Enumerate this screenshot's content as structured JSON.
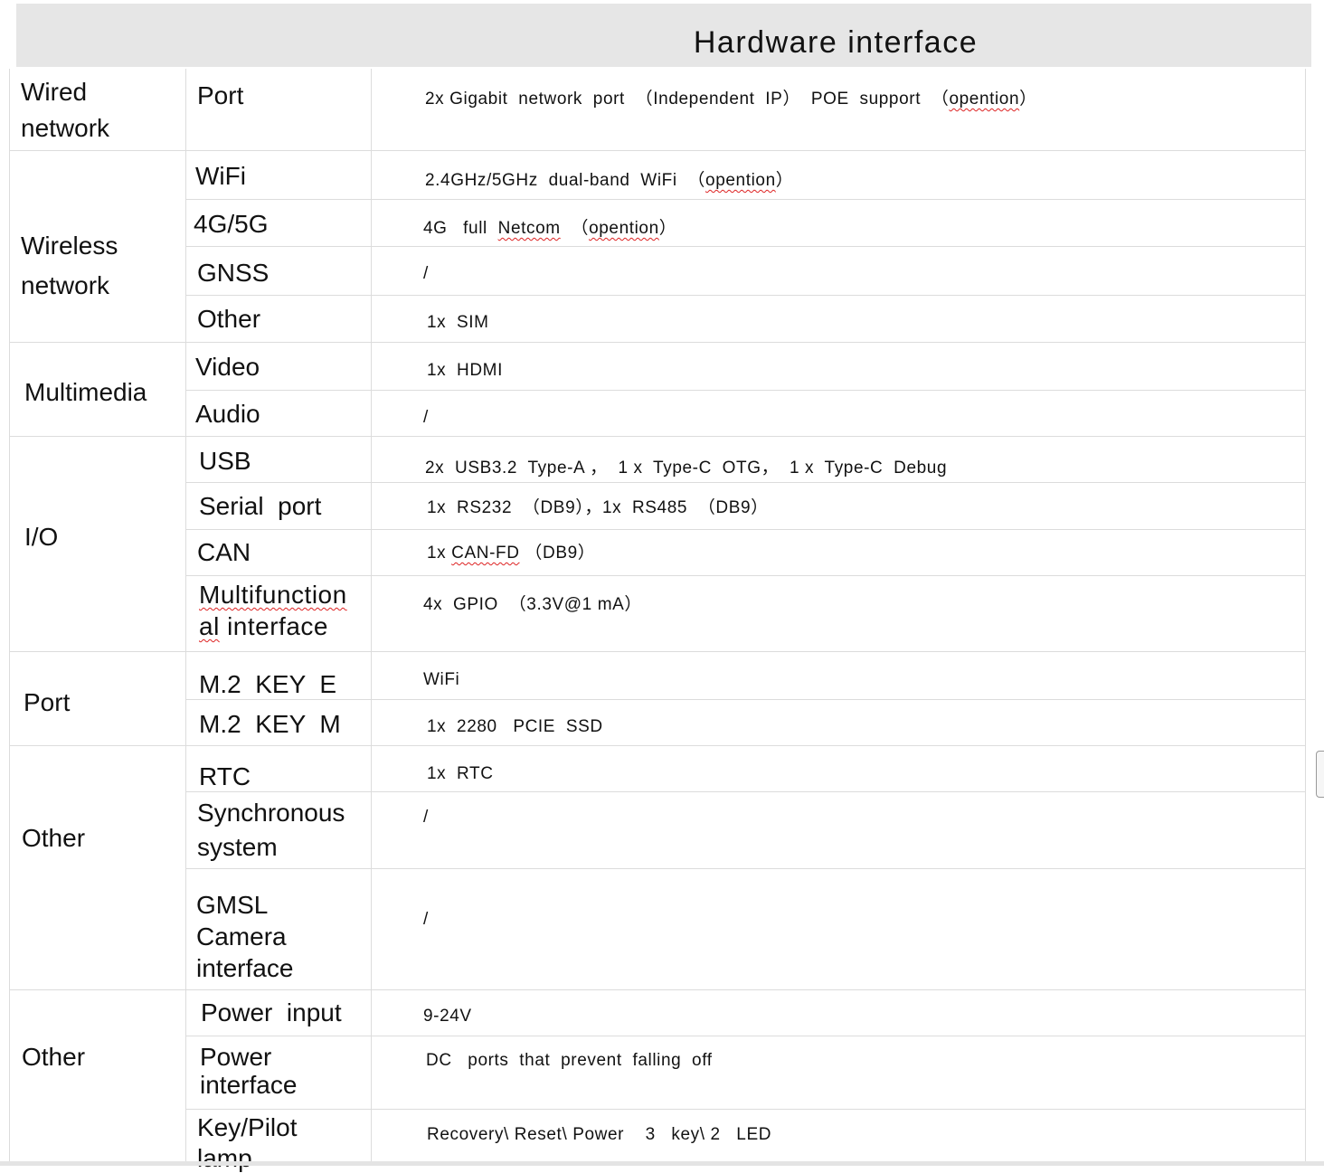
{
  "title": "Hardware  interface",
  "categories": {
    "wired": "Wired\nnetwork",
    "wireless": "Wireless\nnetwork",
    "multimedia": "Multimedia",
    "io": "I/O",
    "port": "Port",
    "other1": "Other",
    "other2": "Other"
  },
  "rows": {
    "port": {
      "item": "Port",
      "value_pre": "2x Gigabit  network  port  （Independent  IP）  POE  support  （",
      "value_mark": "opention",
      "value_post": "）"
    },
    "wifi": {
      "item": "WiFi",
      "value_pre": "2.4GHz/5GHz  dual-band  WiFi  （",
      "value_mark": "opention",
      "value_post": "）"
    },
    "cell": {
      "item": "4G/5G",
      "value_pre": "4G   full  ",
      "value_mark": "Netcom",
      "value_mid": "  （",
      "value_mark2": "opention",
      "value_post": "）"
    },
    "gnss": {
      "item": "GNSS",
      "value": "/"
    },
    "other": {
      "item": "Other",
      "value": "1x  SIM"
    },
    "video": {
      "item": "Video",
      "value": "1x  HDMI"
    },
    "audio": {
      "item": "Audio",
      "value": "/"
    },
    "usb": {
      "item": "USB",
      "value": "2x  USB3.2  Type-A ，  1 x  Type-C  OTG，  1 x  Type-C  Debug"
    },
    "serial": {
      "item": "Serial  port",
      "value": "1x  RS232  （DB9），1x  RS485  （DB9）"
    },
    "can": {
      "item": "CAN",
      "value_pre": "1x ",
      "value_mark": "CAN-FD",
      "value_post": " （DB9）"
    },
    "multi": {
      "item_line1": "Multifunction",
      "item_line2_mark": "al",
      "item_line2_rest": " interface",
      "value": "4x  GPIO  （3.3V@1 mA）"
    },
    "m2e": {
      "item": "M.2  KEY  E",
      "value": "WiFi"
    },
    "m2m": {
      "item": "M.2  KEY  M",
      "value": "1x  2280   PCIE  SSD"
    },
    "rtc": {
      "item": "RTC",
      "value": "1x  RTC"
    },
    "sync": {
      "item": "Synchronous\nsystem",
      "value": "/"
    },
    "gmsl": {
      "item": "GMSL\nCamera\ninterface",
      "value": "/"
    },
    "power_in": {
      "item": "Power  input",
      "value": "9-24V"
    },
    "power_if": {
      "item": "Power\ninterface",
      "value": "DC   ports  that  prevent  falling  off"
    },
    "key": {
      "item": "Key/Pilot\nlamp",
      "value": "Recovery\\ Reset\\ Power    3   key\\ 2   LED"
    }
  }
}
